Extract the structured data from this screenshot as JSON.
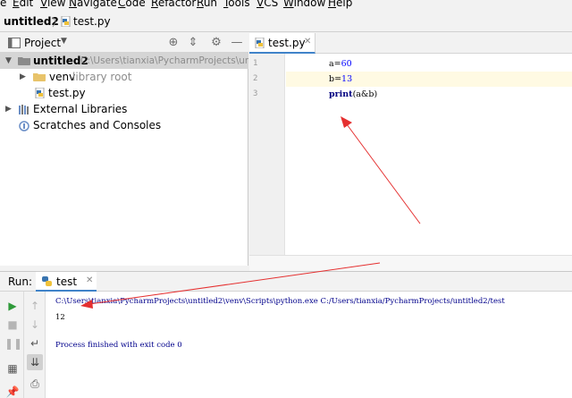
{
  "menu": {
    "items": [
      {
        "text": "e",
        "ul": ""
      },
      {
        "text": "dit",
        "ul": "E"
      },
      {
        "text": "iew",
        "ul": "V"
      },
      {
        "text": "avigate",
        "ul": "N"
      },
      {
        "text": "ode",
        "ul": "C"
      },
      {
        "text": "efactor",
        "ul": "R"
      },
      {
        "text": "un",
        "ul": "R"
      },
      {
        "text": "ools",
        "ul": "T"
      },
      {
        "text": "CS",
        "ul": "V"
      },
      {
        "text": "indow",
        "ul": "W"
      },
      {
        "text": "elp",
        "ul": "H"
      }
    ]
  },
  "nav": {
    "project": "untitled2",
    "separator": "〉",
    "file": "test.py"
  },
  "project_panel": {
    "title": "Project",
    "tree": {
      "root_name": "untitled2",
      "root_path": "C:\\Users\\tianxia\\PycharmProjects\\untit",
      "venv_name": "venv",
      "venv_note": "library root",
      "file": "test.py",
      "external": "External Libraries",
      "scratches": "Scratches and Consoles"
    }
  },
  "editor": {
    "tab": "test.py",
    "line_numbers": [
      "1",
      "2",
      "3"
    ],
    "line1": {
      "var": "a=",
      "num": "60"
    },
    "line2": {
      "var": "b=",
      "num": "13"
    },
    "line3": {
      "kw": "print",
      "rest": "(a&b)"
    }
  },
  "run": {
    "label": "Run:",
    "tab": "test",
    "command": "C:\\Users\\tianxia\\PycharmProjects\\untitled2\\venv\\Scripts\\python.exe C:/Users/tianxia/PycharmProjects/untitled2/test",
    "output": "12",
    "exit_message": "Process finished with exit code 0"
  },
  "colors": {
    "annotation_arrow": "#e53030",
    "accent_tab": "#4083c9",
    "run_green": "#2f9a3a",
    "console_blue": "#00008b"
  }
}
